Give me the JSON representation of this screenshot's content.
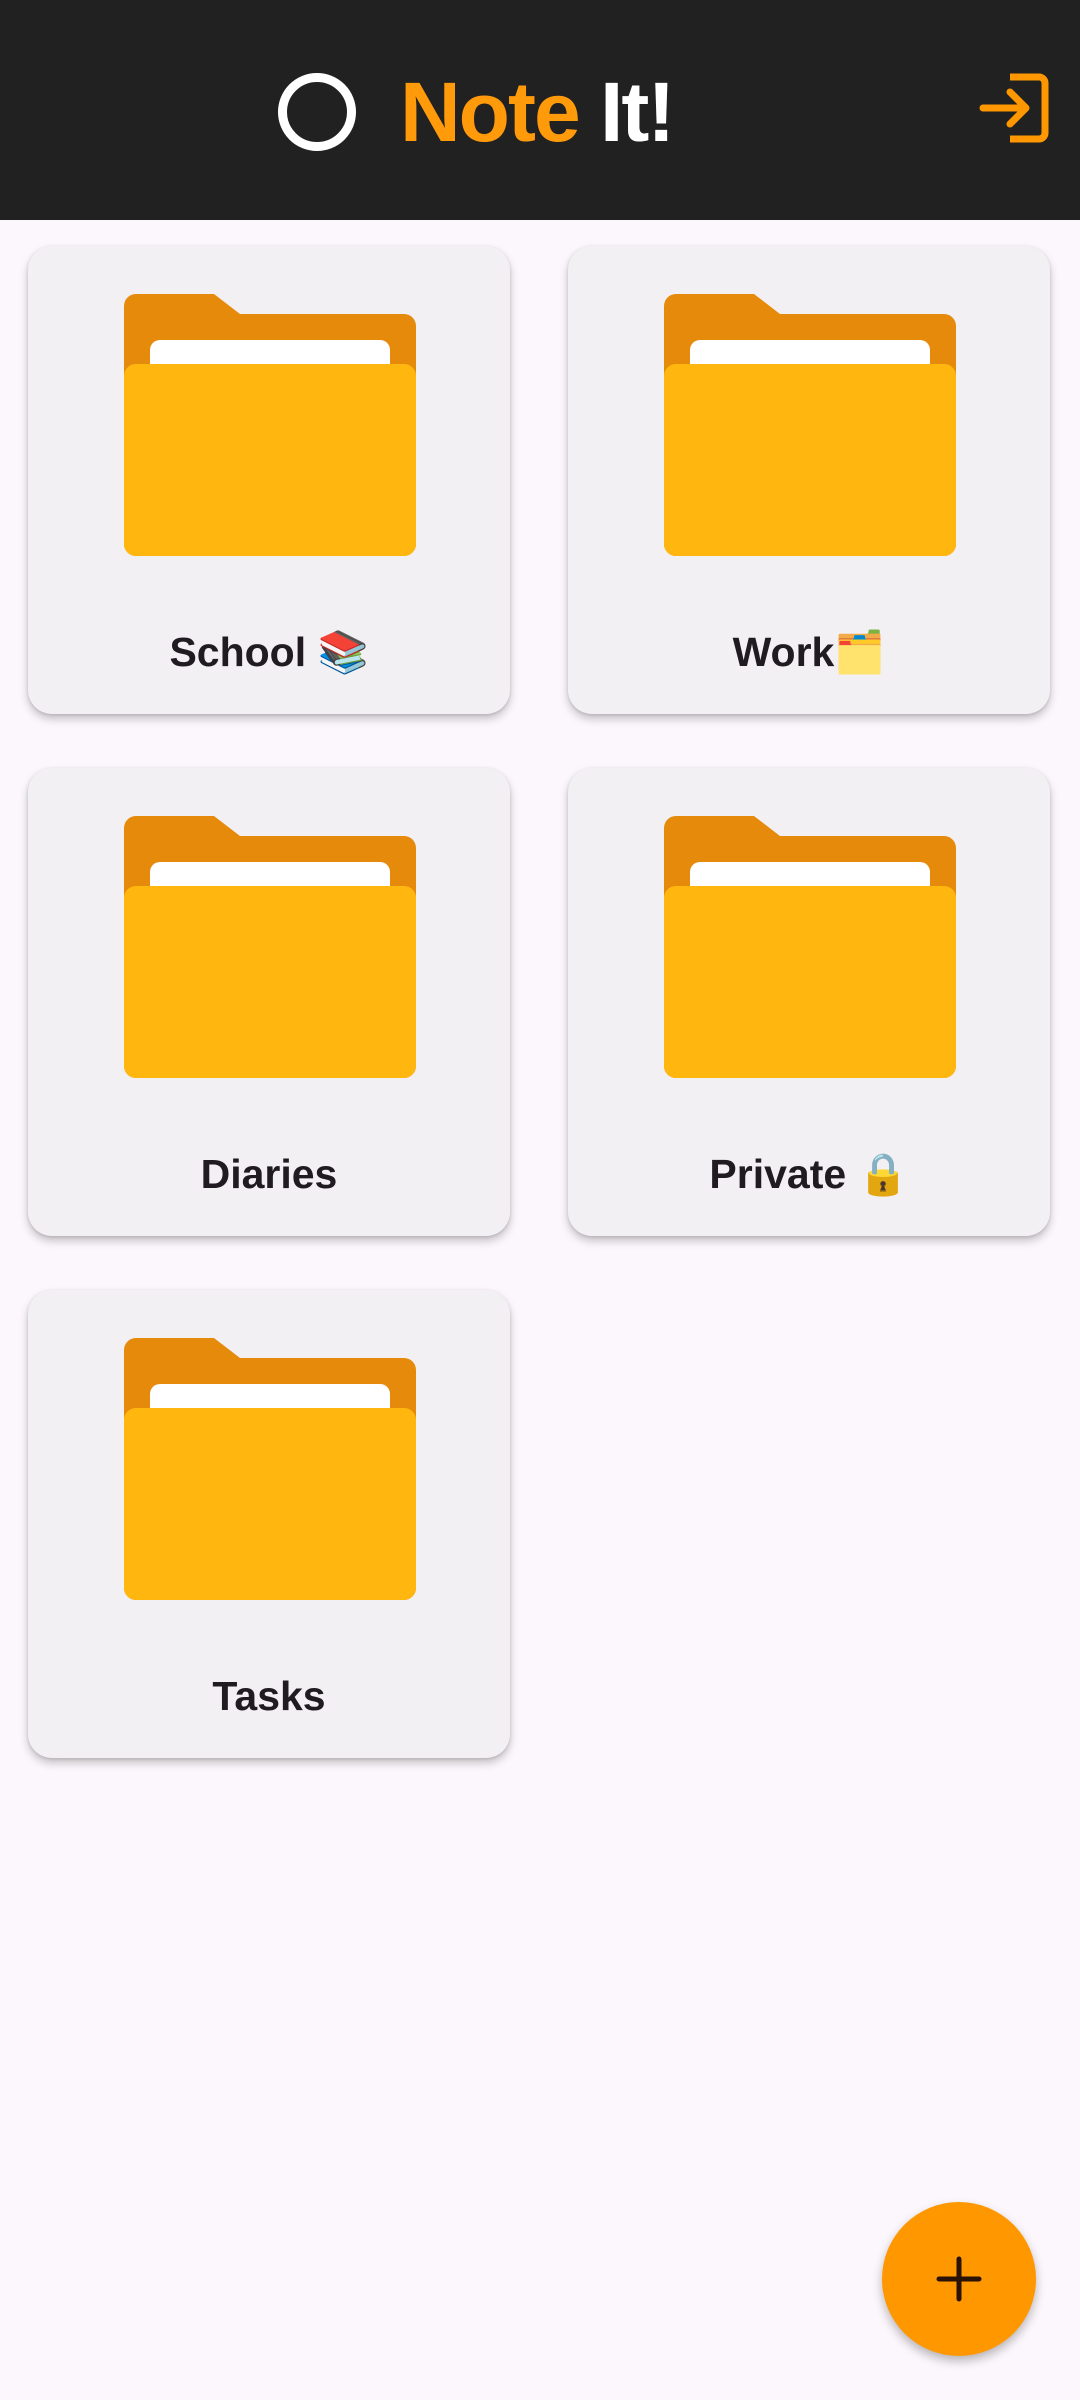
{
  "header": {
    "title_part1": "Note",
    "title_part2": " It!",
    "logo_icon": "ring-icon",
    "logout_icon": "logout-icon"
  },
  "folders": [
    {
      "label": "School 📚"
    },
    {
      "label": "Work🗂️"
    },
    {
      "label": "Diaries"
    },
    {
      "label": "Private 🔒"
    },
    {
      "label": "Tasks"
    }
  ],
  "fab": {
    "icon": "plus-icon"
  },
  "colors": {
    "app_bar": "#212121",
    "accent": "#ff9800",
    "folder_back": "#e68a0c",
    "folder_front": "#ffb70f",
    "card": "#f3f0f4",
    "background": "#fcf7fc"
  }
}
